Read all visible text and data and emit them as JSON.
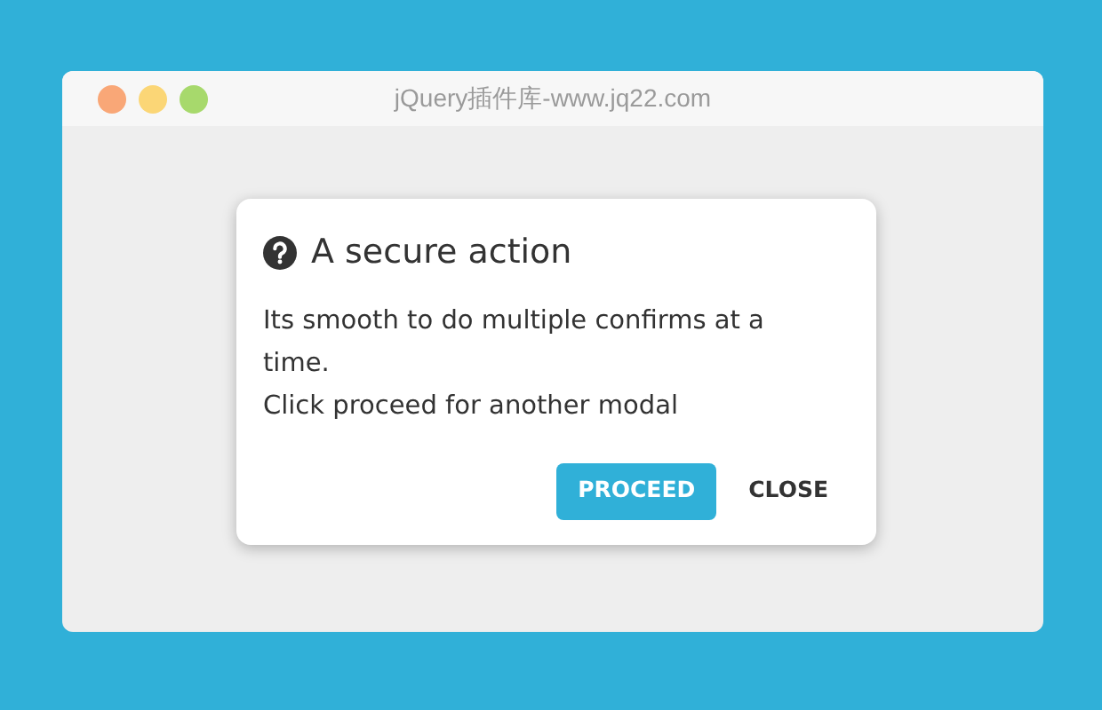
{
  "window": {
    "title": "jQuery插件库-www.jq22.com",
    "dots": [
      {
        "color": "#f9a777"
      },
      {
        "color": "#fbd676"
      },
      {
        "color": "#a7d96c"
      }
    ]
  },
  "modal": {
    "title": "A secure action",
    "lines": [
      "Its smooth to do multiple confirms at a time.",
      "Click proceed for another modal"
    ],
    "buttons": [
      {
        "label": "PROCEED",
        "kind": "primary"
      },
      {
        "label": "CLOSE",
        "kind": "flat"
      }
    ]
  }
}
